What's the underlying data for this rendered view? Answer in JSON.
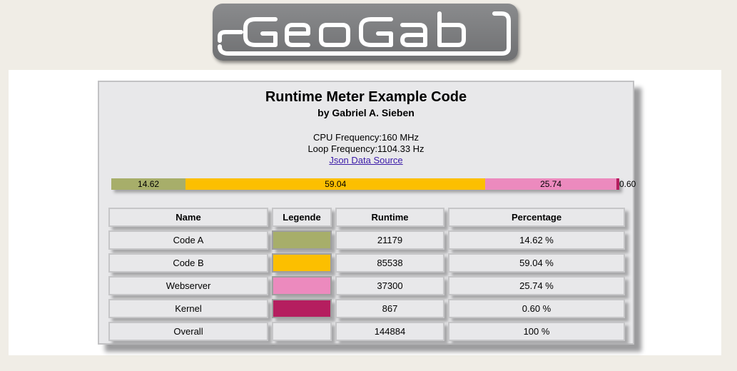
{
  "logo": {
    "text": "GeoGab"
  },
  "header": {
    "title": "Runtime Meter Example Code",
    "subtitle": "by Gabriel A. Sieben",
    "cpu_frequency": "CPU Frequency:160 MHz",
    "loop_frequency": "Loop Frequency:1104.33 Hz",
    "json_link": "Json Data Source"
  },
  "bar": {
    "segments": [
      {
        "label": "14.62",
        "value": 14.62,
        "color": "#a7ae6a"
      },
      {
        "label": "59.04",
        "value": 59.04,
        "color": "#fcbf00"
      },
      {
        "label": "25.74",
        "value": 25.74,
        "color": "#ec8abe"
      },
      {
        "label": "0.60",
        "value": 0.6,
        "color": "#b51e5f"
      }
    ]
  },
  "table": {
    "headers": [
      "Name",
      "Legende",
      "Runtime",
      "Percentage"
    ],
    "rows": [
      {
        "name": "Code A",
        "color": "#a7ae6a",
        "runtime": "21179",
        "percentage": "14.62 %"
      },
      {
        "name": "Code B",
        "color": "#fcbf00",
        "runtime": "85538",
        "percentage": "59.04 %"
      },
      {
        "name": "Webserver",
        "color": "#ec8abe",
        "runtime": "37300",
        "percentage": "25.74 %"
      },
      {
        "name": "Kernel",
        "color": "#b51e5f",
        "runtime": "867",
        "percentage": "0.60 %"
      },
      {
        "name": "Overall",
        "color": "",
        "runtime": "144884",
        "percentage": "100 %"
      }
    ]
  }
}
